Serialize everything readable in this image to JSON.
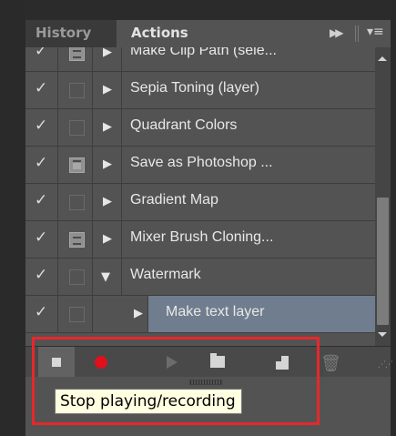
{
  "panel": {
    "tabs": [
      {
        "label": "History",
        "active": false
      },
      {
        "label": "Actions",
        "active": true
      }
    ],
    "tab_icons": {
      "collapse": "double-chevron-right-icon",
      "menu": "panel-menu-icon"
    }
  },
  "actions": [
    {
      "check": "✓",
      "dialog": "on",
      "expanded": false,
      "label": "Make Clip Path (sele...",
      "indent": 0
    },
    {
      "check": "✓",
      "dialog": "off",
      "expanded": false,
      "label": "Sepia Toning (layer)",
      "indent": 0
    },
    {
      "check": "✓",
      "dialog": "off",
      "expanded": false,
      "label": "Quadrant Colors",
      "indent": 0
    },
    {
      "check": "✓",
      "dialog": "on-full",
      "expanded": false,
      "label": "Save as Photoshop ...",
      "indent": 0
    },
    {
      "check": "✓",
      "dialog": "off",
      "expanded": false,
      "label": "Gradient Map",
      "indent": 0
    },
    {
      "check": "✓",
      "dialog": "on",
      "expanded": false,
      "label": "Mixer Brush Cloning...",
      "indent": 0
    },
    {
      "check": "✓",
      "dialog": "off",
      "expanded": true,
      "label": "Watermark",
      "indent": 0
    },
    {
      "check": "✓",
      "dialog": "off",
      "expanded": false,
      "label": "Make text layer",
      "indent": 1,
      "selected": true
    }
  ],
  "toolbar": {
    "buttons": [
      {
        "name": "stop-button",
        "icon": "stop-icon"
      },
      {
        "name": "record-button",
        "icon": "record-icon"
      },
      {
        "name": "play-button",
        "icon": "play-icon"
      },
      {
        "name": "new-set-button",
        "icon": "folder-icon"
      },
      {
        "name": "new-action-button",
        "icon": "new-action-icon"
      },
      {
        "name": "delete-button",
        "icon": "trash-icon"
      }
    ]
  },
  "tooltip": {
    "text": "Stop playing/recording"
  },
  "colors": {
    "record": "#e0101c",
    "highlight": "#e8272a",
    "selected_row": "#6f7d8e",
    "tooltip_bg": "#ffffe1"
  }
}
